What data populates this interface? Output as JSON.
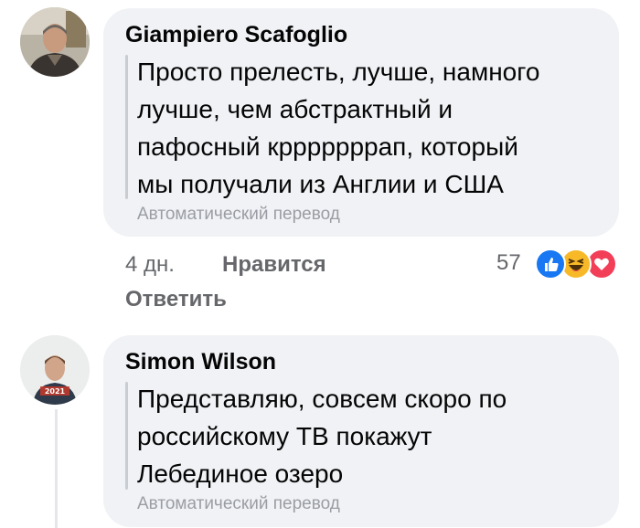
{
  "comments": [
    {
      "author": "Giampiero Scafoglio",
      "lines": [
        "Просто прелесть, лучше, намного",
        "лучше, чем абстрактный и",
        "пафосный крррррррап, который",
        "мы получали из Англии и США"
      ],
      "translation_label": "Автоматический перевод",
      "time": "4 дн.",
      "like_label": "Нравится",
      "reply_label": "Ответить",
      "reaction_count": "57",
      "reactions": [
        "like",
        "haha",
        "love"
      ]
    },
    {
      "author": "Simon Wilson",
      "lines": [
        "Представляю, совсем скоро по",
        "российскому ТВ покажут",
        "Лебединое озеро"
      ],
      "translation_label": "Автоматический перевод",
      "avatar_caption": "2021"
    }
  ],
  "colors": {
    "like_blue": "#1877f2",
    "haha_yellow": "#f7b928",
    "love_red": "#f33e58",
    "bubble_bg": "#f0f2f5"
  }
}
